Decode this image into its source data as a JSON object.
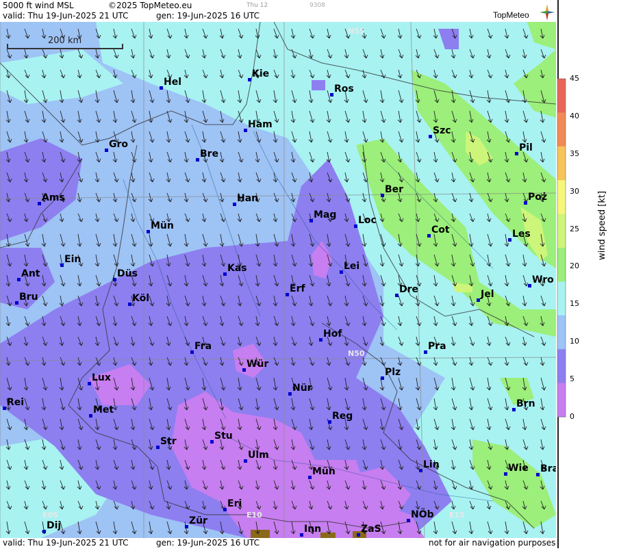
{
  "header": {
    "title": "5000 ft wind MSL",
    "copyright": "©2025 TopMeteo.eu",
    "valid": "valid:  Thu  19-Jun-2025  21 UTC",
    "gen": "gen: 19-Jun-2025 16 UTC",
    "small_day": "Thu 12",
    "small_code": "9308"
  },
  "footer": {
    "valid": "valid:  Thu  19-Jun-2025  21 UTC",
    "gen": "gen: 19-Jun-2025 16 UTC",
    "disclaimer": "not for air navigation purposes"
  },
  "logo": {
    "text": "TopMeteo"
  },
  "scale_bar": {
    "label": "200 km"
  },
  "legend": {
    "title": "wind speed  [kt]",
    "ticks": [
      "45",
      "40",
      "35",
      "30",
      "25",
      "20",
      "15",
      "10",
      "5",
      "0"
    ],
    "colors": {
      "0_5": "#c77ef0",
      "5_10": "#8d7ff0",
      "10_15": "#9ec3f5",
      "15_20": "#a8f2f2",
      "20_25": "#9bef7a",
      "25_30": "#cdf57a",
      "30_35": "#f6f67a",
      "35_40": "#f5c45a",
      "40_45": "#f28a55",
      "45_plus": "#e9655a"
    }
  },
  "grid_labels": {
    "n55": "N55",
    "n50": "N50",
    "e05": "E05",
    "e10": "E10",
    "e15": "E15"
  },
  "cities": [
    {
      "name": "Hel"
    },
    {
      "name": "Kie"
    },
    {
      "name": "Ros"
    },
    {
      "name": "Ham"
    },
    {
      "name": "Szc"
    },
    {
      "name": "Gro"
    },
    {
      "name": "Bre"
    },
    {
      "name": "Pil"
    },
    {
      "name": "Ber"
    },
    {
      "name": "Poż"
    },
    {
      "name": "Ams"
    },
    {
      "name": "Han"
    },
    {
      "name": "Mag"
    },
    {
      "name": "Loc"
    },
    {
      "name": "Mün"
    },
    {
      "name": "Cot"
    },
    {
      "name": "Les"
    },
    {
      "name": "Ein"
    },
    {
      "name": "Kas"
    },
    {
      "name": "Lei"
    },
    {
      "name": "Ant"
    },
    {
      "name": "Düs"
    },
    {
      "name": "Wro"
    },
    {
      "name": "Bru"
    },
    {
      "name": "Köl"
    },
    {
      "name": "Erf"
    },
    {
      "name": "Dre"
    },
    {
      "name": "Jel"
    },
    {
      "name": "Hof"
    },
    {
      "name": "Fra"
    },
    {
      "name": "Pra"
    },
    {
      "name": "Wür"
    },
    {
      "name": "Lux"
    },
    {
      "name": "Plz"
    },
    {
      "name": "Nür"
    },
    {
      "name": "Rei"
    },
    {
      "name": "Met"
    },
    {
      "name": "Brn"
    },
    {
      "name": "Reg"
    },
    {
      "name": "Stu"
    },
    {
      "name": "Str"
    },
    {
      "name": "Ulm"
    },
    {
      "name": "Lin"
    },
    {
      "name": "Wie"
    },
    {
      "name": "Bra"
    },
    {
      "name": "Mün"
    },
    {
      "name": "Eri"
    },
    {
      "name": "NÖb"
    },
    {
      "name": "Dij"
    },
    {
      "name": "Zür"
    },
    {
      "name": "Inn"
    },
    {
      "name": "ZaS"
    }
  ]
}
